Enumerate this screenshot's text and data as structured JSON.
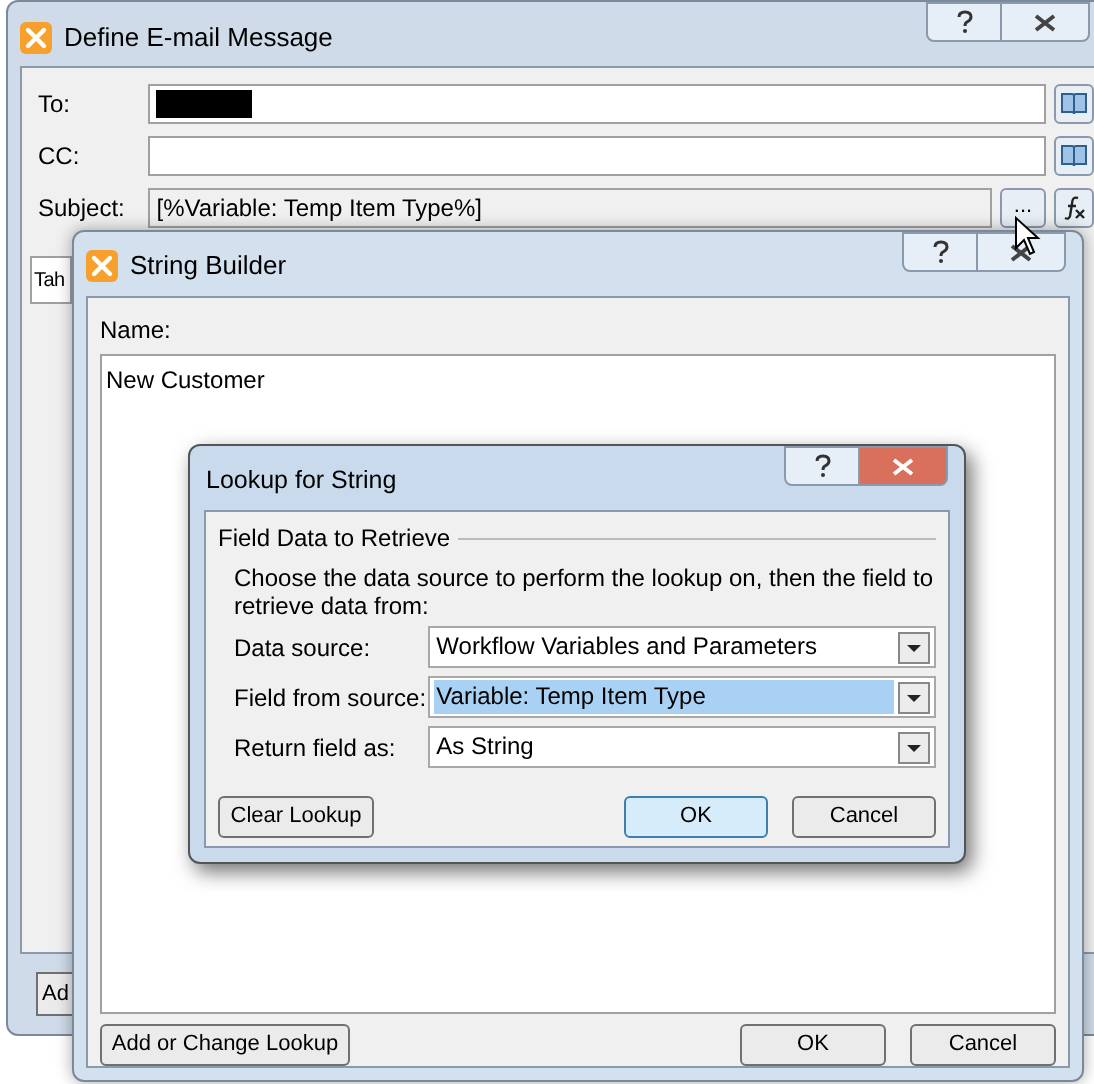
{
  "email_window": {
    "title": "Define E-mail Message",
    "fields": [
      {
        "label": "To:",
        "redacted": true,
        "kind": "address"
      },
      {
        "label": "CC:",
        "kind": "address"
      },
      {
        "label": "Subject:",
        "value": "[%Variable: Temp Item Type%]",
        "kind": "subject",
        "browse_button": "..."
      }
    ],
    "partial_field": "Tah",
    "partial_button": "Ad"
  },
  "string_builder": {
    "title": "String Builder",
    "name_label": "Name:",
    "text": "New Customer",
    "buttons": [
      {
        "label": "Add or Change Lookup",
        "default": false
      },
      {
        "label": "OK",
        "default": false
      },
      {
        "label": "Cancel",
        "default": false
      }
    ]
  },
  "lookup_dialog": {
    "title": "Lookup for String",
    "group_title": "Field Data to Retrieve",
    "instructions": "Choose the data source to perform the lookup on, then the field to retrieve data from:",
    "rows": [
      {
        "label": "Data source:",
        "value": "Workflow Variables and Parameters",
        "selected": false
      },
      {
        "label": "Field from source:",
        "value": "Variable: Temp Item Type",
        "selected": true
      },
      {
        "label": "Return field as:",
        "value": "As String",
        "selected": false
      }
    ],
    "buttons": [
      {
        "label": "Clear Lookup",
        "default": false
      },
      {
        "label": "OK",
        "default": true
      },
      {
        "label": "Cancel",
        "default": false
      }
    ]
  }
}
